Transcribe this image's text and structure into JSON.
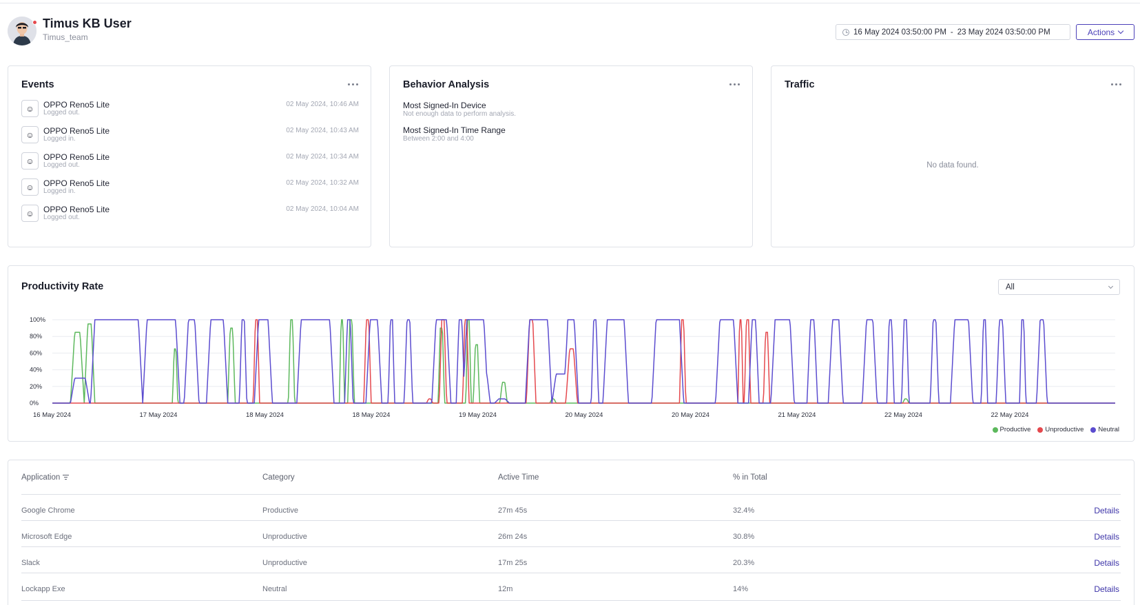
{
  "user": {
    "name": "Timus KB User",
    "team": "Timus_team"
  },
  "header": {
    "date_from": "16 May 2024 03:50:00 PM",
    "date_separator": "-",
    "date_to": "23 May 2024 03:50:00 PM",
    "actions_label": "Actions"
  },
  "events": {
    "title": "Events",
    "items": [
      {
        "device": "OPPO Reno5 Lite",
        "status": "Logged out.",
        "time": "02 May 2024, 10:46 AM"
      },
      {
        "device": "OPPO Reno5 Lite",
        "status": "Logged in.",
        "time": "02 May 2024, 10:43 AM"
      },
      {
        "device": "OPPO Reno5 Lite",
        "status": "Logged out.",
        "time": "02 May 2024, 10:34 AM"
      },
      {
        "device": "OPPO Reno5 Lite",
        "status": "Logged in.",
        "time": "02 May 2024, 10:32 AM"
      },
      {
        "device": "OPPO Reno5 Lite",
        "status": "Logged out.",
        "time": "02 May 2024, 10:04 AM"
      }
    ]
  },
  "behavior": {
    "title": "Behavior Analysis",
    "device_label": "Most Signed-In Device",
    "device_value": "Not enough data to perform analysis.",
    "time_label": "Most Signed-In Time Range",
    "time_value": "Between 2:00 and 4:00"
  },
  "traffic": {
    "title": "Traffic",
    "empty_text": "No data found."
  },
  "productivity": {
    "title": "Productivity Rate",
    "filter_value": "All"
  },
  "chart_data": {
    "type": "line",
    "y_ticks": [
      "0%",
      "20%",
      "40%",
      "60%",
      "80%",
      "100%"
    ],
    "ylim": [
      0,
      100
    ],
    "x_tick_labels": [
      "16 May 2024",
      "17 May 2024",
      "18 May 2024",
      "18 May 2024",
      "19 May 2024",
      "20 May 2024",
      "20 May 2024",
      "21 May 2024",
      "22 May 2024",
      "22 May 2024"
    ],
    "colors": {
      "Productive": "#5cb85c",
      "Unproductive": "#e5484d",
      "Neutral": "#5b4ccf"
    },
    "series": [
      {
        "name": "Neutral",
        "pulses": [
          [
            0.036,
            0.085,
            100
          ],
          [
            0.085,
            0.12,
            100
          ],
          [
            0.124,
            0.138,
            100
          ],
          [
            0.145,
            0.165,
            100
          ],
          [
            0.176,
            0.183,
            100
          ],
          [
            0.19,
            0.207,
            100
          ],
          [
            0.23,
            0.265,
            100
          ],
          [
            0.275,
            0.283,
            100
          ],
          [
            0.295,
            0.31,
            100
          ],
          [
            0.316,
            0.322,
            100
          ],
          [
            0.331,
            0.339,
            100
          ],
          [
            0.357,
            0.375,
            100
          ],
          [
            0.38,
            0.388,
            100
          ],
          [
            0.386,
            0.41,
            100
          ],
          [
            0.445,
            0.47,
            100
          ],
          [
            0.481,
            0.495,
            100
          ],
          [
            0.507,
            0.514,
            100
          ],
          [
            0.518,
            0.542,
            100
          ],
          [
            0.564,
            0.594,
            100
          ],
          [
            0.624,
            0.645,
            100
          ],
          [
            0.655,
            0.665,
            100
          ],
          [
            0.676,
            0.698,
            100
          ],
          [
            0.71,
            0.72,
            100
          ],
          [
            0.73,
            0.744,
            100
          ],
          [
            0.762,
            0.776,
            100
          ],
          [
            0.785,
            0.792,
            100
          ],
          [
            0.799,
            0.806,
            100
          ],
          [
            0.826,
            0.834,
            100
          ],
          [
            0.845,
            0.866,
            100
          ],
          [
            0.874,
            0.88,
            100
          ],
          [
            0.888,
            0.897,
            100
          ],
          [
            0.91,
            0.916,
            100
          ],
          [
            0.926,
            0.936,
            100
          ]
        ],
        "extra": [
          [
            0.017,
            0.035,
            30
          ],
          [
            0.111,
            0.118,
            10
          ],
          [
            0.404,
            0.412,
            30
          ],
          [
            0.416,
            0.43,
            5
          ],
          [
            0.448,
            0.458,
            5
          ],
          [
            0.452,
            0.46,
            3
          ],
          [
            0.47,
            0.488,
            35
          ]
        ]
      },
      {
        "name": "Productive",
        "pulses": [
          [
            0.017,
            0.03,
            85
          ],
          [
            0.03,
            0.04,
            95
          ],
          [
            0.113,
            0.118,
            65
          ],
          [
            0.165,
            0.172,
            90
          ],
          [
            0.222,
            0.228,
            100
          ],
          [
            0.27,
            0.275,
            100
          ],
          [
            0.278,
            0.284,
            100
          ],
          [
            0.363,
            0.369,
            90
          ],
          [
            0.389,
            0.394,
            100
          ],
          [
            0.396,
            0.402,
            70
          ],
          [
            0.421,
            0.428,
            25
          ],
          [
            0.468,
            0.474,
            5
          ],
          [
            0.8,
            0.806,
            5
          ]
        ],
        "extra": []
      },
      {
        "name": "Unproductive",
        "pulses": [
          [
            0.189,
            0.195,
            100
          ],
          [
            0.293,
            0.3,
            100
          ],
          [
            0.364,
            0.371,
            100
          ],
          [
            0.386,
            0.392,
            100
          ],
          [
            0.446,
            0.455,
            100
          ],
          [
            0.483,
            0.494,
            65
          ],
          [
            0.59,
            0.596,
            100
          ],
          [
            0.645,
            0.65,
            100
          ],
          [
            0.651,
            0.657,
            100
          ],
          [
            0.669,
            0.675,
            85
          ],
          [
            0.352,
            0.358,
            5
          ]
        ],
        "extra": []
      }
    ],
    "legend": [
      "Productive",
      "Unproductive",
      "Neutral"
    ]
  },
  "table": {
    "headers": {
      "application": "Application",
      "category": "Category",
      "active_time": "Active Time",
      "percent": "% in Total"
    },
    "rows": [
      {
        "application": "Google Chrome",
        "category": "Productive",
        "active_time": "27m 45s",
        "percent": "32.4%",
        "action": "Details"
      },
      {
        "application": "Microsoft Edge",
        "category": "Unproductive",
        "active_time": "26m 24s",
        "percent": "30.8%",
        "action": "Details"
      },
      {
        "application": "Slack",
        "category": "Unproductive",
        "active_time": "17m 25s",
        "percent": "20.3%",
        "action": "Details"
      },
      {
        "application": "Lockapp Exe",
        "category": "Neutral",
        "active_time": "12m",
        "percent": "14%",
        "action": "Details"
      }
    ]
  }
}
